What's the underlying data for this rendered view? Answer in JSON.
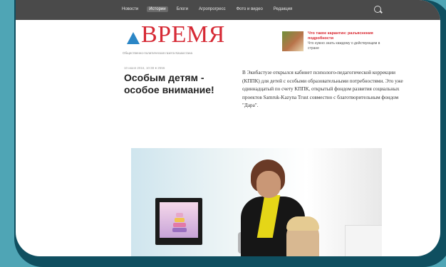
{
  "nav": {
    "items": [
      {
        "label": "Новости",
        "active": false
      },
      {
        "label": "Истории",
        "active": true
      },
      {
        "label": "Блоги",
        "active": false
      },
      {
        "label": "Агропрогресс",
        "active": false
      },
      {
        "label": "Фото и видео",
        "active": false
      },
      {
        "label": "Редакция",
        "active": false
      }
    ],
    "search_icon": "search-icon"
  },
  "logo": {
    "text": "ВРЕМЯ",
    "tagline": "Общественно-политическая газета Казахстана"
  },
  "promo": {
    "title": "Что такое карантин: разъяснения подробности",
    "body": "Что нужно знать каждому о действующем в стране"
  },
  "article": {
    "meta": "10 июня 2016, 10:38   ● 2556",
    "headline": "Особым детям - особое внимание!",
    "body": "В Экибастузе открылся кабинет психолого-педагогической коррекции (КППК) для детей с особыми образовательными потребностями. Это уже одиннадцатый по счету КППК, открытый фондом развития социальных проектов Samruk-Kazyna Trust совместно с благотворительным фондом \"Дара\"."
  },
  "colors": {
    "frame": "#4fa5b5",
    "topbar": "#4a4a4a",
    "logo_red": "#d62a35",
    "logo_blue": "#2b86c6"
  }
}
